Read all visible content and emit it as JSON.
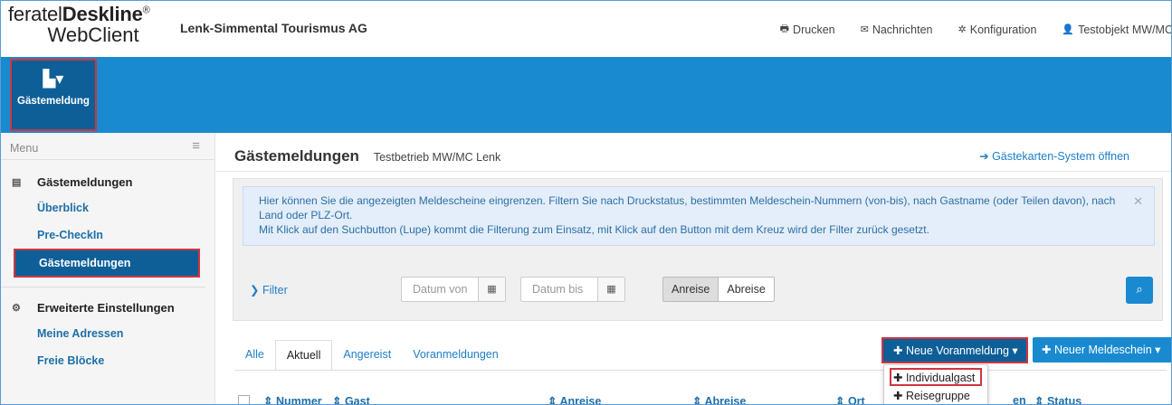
{
  "app": {
    "logo_line1_light": "feratel",
    "logo_line1_bold": "Deskline",
    "logo_reg": "®",
    "logo_line2": "WebClient",
    "company": "Lenk-Simmental Tourismus AG"
  },
  "topnav": [
    {
      "icon": "printer-icon",
      "glyph": "🖶",
      "label": "Drucken"
    },
    {
      "icon": "envelope-icon",
      "glyph": "✉",
      "label": "Nachrichten"
    },
    {
      "icon": "gear-icon",
      "glyph": "✲",
      "label": "Konfiguration"
    },
    {
      "icon": "user-icon",
      "glyph": "👤",
      "label": "Testobjekt MW/MC"
    }
  ],
  "band": {
    "label": "Gästemeldung",
    "icon": "documents-dropdown-icon"
  },
  "sidebar": {
    "menu_label": "Menu",
    "sections": [
      {
        "title": "Gästemeldungen",
        "icon": "list-icon",
        "items": [
          "Überblick",
          "Pre-CheckIn",
          "Gästemeldungen"
        ]
      },
      {
        "title": "Erweiterte Einstellungen",
        "icon": "cogs-icon",
        "items": [
          "Meine Adressen",
          "Freie Blöcke"
        ]
      }
    ]
  },
  "main": {
    "title": "Gästemeldungen",
    "subtitle": "Testbetrieb MW/MC Lenk",
    "link": "Gästekarten-System öffnen",
    "info_line1": "Hier können Sie die angezeigten Meldescheine eingrenzen. Filtern Sie nach Druckstatus, bestimmten Meldeschein-Nummern (von-bis), nach Gastname (oder Teilen davon), nach Land oder PLZ-Ort.",
    "info_line2": "Mit Klick auf den Suchbutton (Lupe) kommt die Filterung zum Einsatz, mit Klick auf den Button mit dem Kreuz wird der Filter zurück gesetzt.",
    "filter_label": "Filter",
    "date_from_placeholder": "Datum von",
    "date_to_placeholder": "Datum bis",
    "seg_arrival": "Anreise",
    "seg_departure": "Abreise",
    "tabs": [
      "Alle",
      "Aktuell",
      "Angereist",
      "Voranmeldungen"
    ],
    "active_tab": "Aktuell",
    "btn_pre_registration": "Neue Voranmeldung",
    "btn_new_form": "Neuer Meldeschein",
    "dropdown": [
      "Individualgast",
      "Reisegruppe"
    ],
    "columns": [
      "Nummer",
      "Gast",
      "Anreise",
      "Abreise",
      "Ort",
      "en",
      "Status"
    ]
  },
  "colors": {
    "accent": "#1a8ad0",
    "dark_accent": "#0e5f98",
    "highlight": "#d0353f"
  }
}
